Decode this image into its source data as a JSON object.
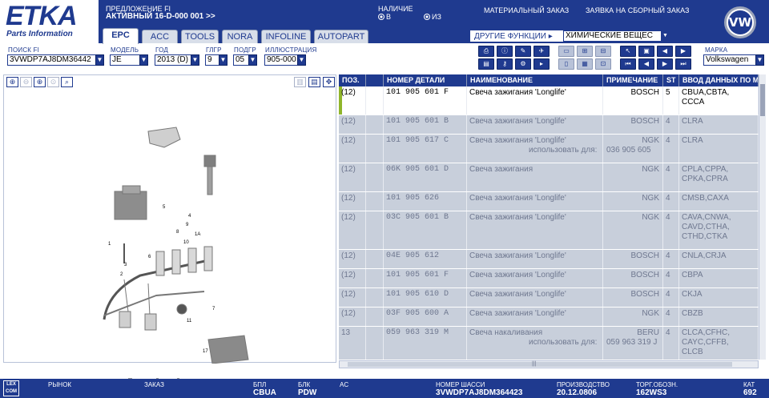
{
  "header": {
    "logo_text": "ETKA",
    "logo_sub": "Parts Information",
    "offer_label": "ПРЕДЛОЖЕНИЕ FI",
    "offer_value": "АКТИВНЫЙ  16-D-000 001 >>",
    "availability_label": "НАЛИЧИЕ",
    "radio_b": "B",
    "radio_iz": "ИЗ",
    "material_order": "МАТЕРИАЛЬНЫЙ ЗАКАЗ",
    "assembly_order": "ЗАЯВКА НА СБОРНЫЙ ЗАКАЗ",
    "brand_logo": "VW"
  },
  "tabs": [
    {
      "label": "EPC",
      "active": true
    },
    {
      "label": "ACC",
      "active": false
    },
    {
      "label": "TOOLS",
      "active": false
    },
    {
      "label": "NORA",
      "active": false
    },
    {
      "label": "INFOLINE",
      "active": false
    },
    {
      "label": "AUTOPART",
      "active": false
    }
  ],
  "functions": {
    "label": "ДРУГИЕ ФУНКЦИИ ▸",
    "value": "ХИМИЧЕСКИЕ ВЕЩЕС"
  },
  "filters": {
    "search_label": "ПОИСК FI",
    "search_value": "3VWDP7AJ8DM36442",
    "model_label": "МОДЕЛЬ",
    "model_value": "JE",
    "year_label": "ГОД",
    "year_value": "2013 (D)",
    "mg_label": "ГЛГР",
    "mg_value": "9",
    "sg_label": "ПОДГР",
    "sg_value": "05",
    "illus_label": "ИЛЛЮСТРАЦИЯ",
    "illus_value": "905-000",
    "brand_label": "МАРКА",
    "brand_value": "Volkswagen"
  },
  "table": {
    "headers": [
      "ПОЗ.",
      "",
      "НОМЕР ДЕТАЛИ",
      "НАИМЕНОВАНИЕ",
      "ПРИМЕЧАНИЕ",
      "ST",
      "ВВОД ДАННЫХ ПО М"
    ],
    "usage_label": "использовать для:",
    "rows": [
      {
        "pos": "(12)",
        "part": "101  905  601  F",
        "name": "Свеча зажигания 'Longlife'",
        "note": "BOSCH",
        "st": "5",
        "data": [
          "CBUA,CBTA,",
          "CCCA"
        ],
        "selected": true,
        "usage": ""
      },
      {
        "pos": "(12)",
        "part": "101  905  601  B",
        "name": "Свеча зажигания 'Longlife'",
        "note": "BOSCH",
        "st": "4",
        "data": [
          "CLRA"
        ],
        "selected": false,
        "usage": ""
      },
      {
        "pos": "(12)",
        "part": "101  905  617  C",
        "name": "Свеча зажигания 'Longlife'",
        "note": "NGK",
        "st": "4",
        "data": [
          "CLRA"
        ],
        "selected": false,
        "usage": "036 905 605"
      },
      {
        "pos": "(12)",
        "part": "06K  905  601  D",
        "name": "Свеча зажигания",
        "note": "NGK",
        "st": "4",
        "data": [
          "CPLA,CPPA,",
          "CPKA,CPRA"
        ],
        "selected": false,
        "usage": ""
      },
      {
        "pos": "(12)",
        "part": "101  905  626",
        "name": "Свеча зажигания 'Longlife'",
        "note": "NGK",
        "st": "4",
        "data": [
          "CMSB,CAXA"
        ],
        "selected": false,
        "usage": ""
      },
      {
        "pos": "(12)",
        "part": "03C  905  601  B",
        "name": "Свеча зажигания 'Longlife'",
        "note": "NGK",
        "st": "4",
        "data": [
          "CAVA,CNWA,",
          "CAVD,CTHA,",
          "CTHD,CTKA"
        ],
        "selected": false,
        "usage": ""
      },
      {
        "pos": "(12)",
        "part": "04E  905  612",
        "name": "Свеча зажигания 'Longlife'",
        "note": "BOSCH",
        "st": "4",
        "data": [
          "CNLA,CRJA"
        ],
        "selected": false,
        "usage": ""
      },
      {
        "pos": "(12)",
        "part": "101  905  601  F",
        "name": "Свеча зажигания 'Longlife'",
        "note": "BOSCH",
        "st": "4",
        "data": [
          "CBPA"
        ],
        "selected": false,
        "usage": ""
      },
      {
        "pos": "(12)",
        "part": "101  905  610  D",
        "name": "Свеча зажигания 'Longlife'",
        "note": "BOSCH",
        "st": "4",
        "data": [
          "CKJA"
        ],
        "selected": false,
        "usage": ""
      },
      {
        "pos": "(12)",
        "part": "03F  905  600  A",
        "name": "Свеча зажигания 'Longlife'",
        "note": "NGK",
        "st": "4",
        "data": [
          "CBZB"
        ],
        "selected": false,
        "usage": ""
      },
      {
        "pos": "13",
        "part": "059  963  319  M",
        "name": "Свеча накаливания",
        "note": "BERU",
        "st": "4",
        "data": [
          "CLCA,CFHC,",
          "CAYC,CFFB,",
          "CLCB"
        ],
        "selected": false,
        "usage": "059 963 319 J"
      }
    ]
  },
  "diagram": {
    "labels": [
      "1",
      "1A",
      "2",
      "3",
      "4",
      "5",
      "6",
      "7",
      "8",
      "9",
      "10",
      "11",
      "12",
      "13",
      "14",
      "17",
      "18"
    ],
    "highlight": "12",
    "highlight_color": "#f2c21b"
  },
  "footer": {
    "logo": "LEX COM",
    "market_label": "РЫНОК",
    "order_label": "ЗАКАЗ",
    "bpl_label": "БПЛ",
    "bpl_value": "CBUA",
    "blk_label": "БЛК",
    "blk_value": "PDW",
    "ac_label": "AC",
    "chassis_label": "НОМЕР ШАССИ",
    "chassis_value": "3VWDP7AJ8DM364423",
    "prod_label": "ПРОИЗВОДСТВО",
    "prod_value": "20.12.0806",
    "code_label": "ТОРГ.ОБОЗН.",
    "code_value": "162WS3",
    "cat_label": "КАТ",
    "cat_value": "692"
  },
  "colors": {
    "brand_blue": "#1f3a8f",
    "row_bg": "#c8cfdb",
    "selection_mark": "#8fb52a"
  }
}
